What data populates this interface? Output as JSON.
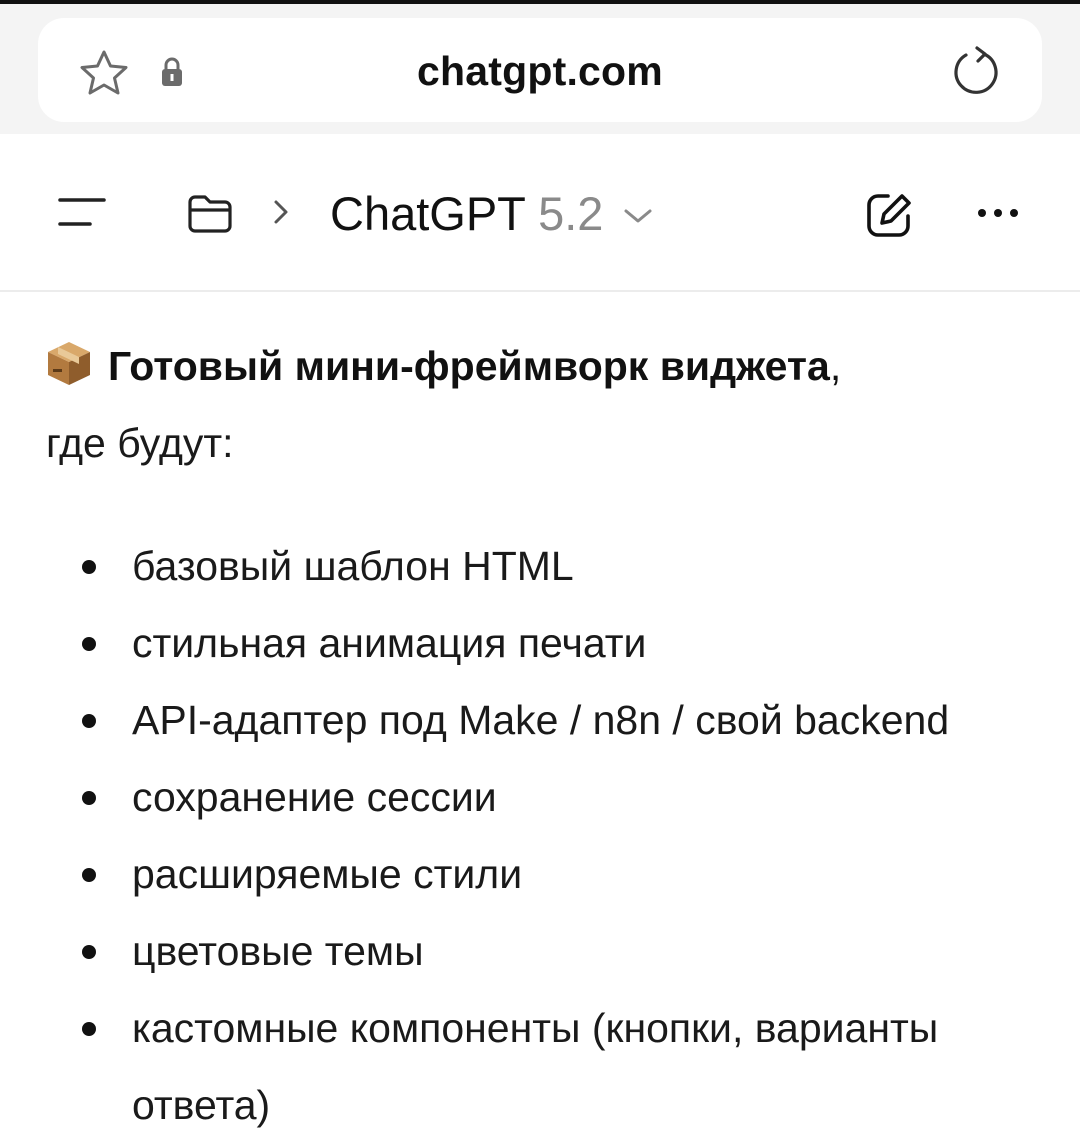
{
  "browser": {
    "url": "chatgpt.com",
    "icons": [
      "star-icon",
      "lock-icon",
      "reload-icon"
    ]
  },
  "header": {
    "model_name": "ChatGPT",
    "model_version": "5.2",
    "icons": [
      "menu-icon",
      "folder-icon",
      "chevron-right-icon",
      "chevron-down-icon",
      "new-chat-icon",
      "more-icon"
    ]
  },
  "message": {
    "heading_emoji": "package-icon",
    "heading_bold": "Готовый мини-фреймворк виджета",
    "heading_suffix": ",",
    "subline": "где будут:",
    "bullets": [
      "базовый шаблон HTML",
      "стильная анимация печати",
      "API-адаптер под Make / n8n / свой backend",
      "сохранение сессии",
      "расширяемые стили",
      "цветовые темы",
      "кастомные компоненты (кнопки, варианты ответа)"
    ]
  }
}
